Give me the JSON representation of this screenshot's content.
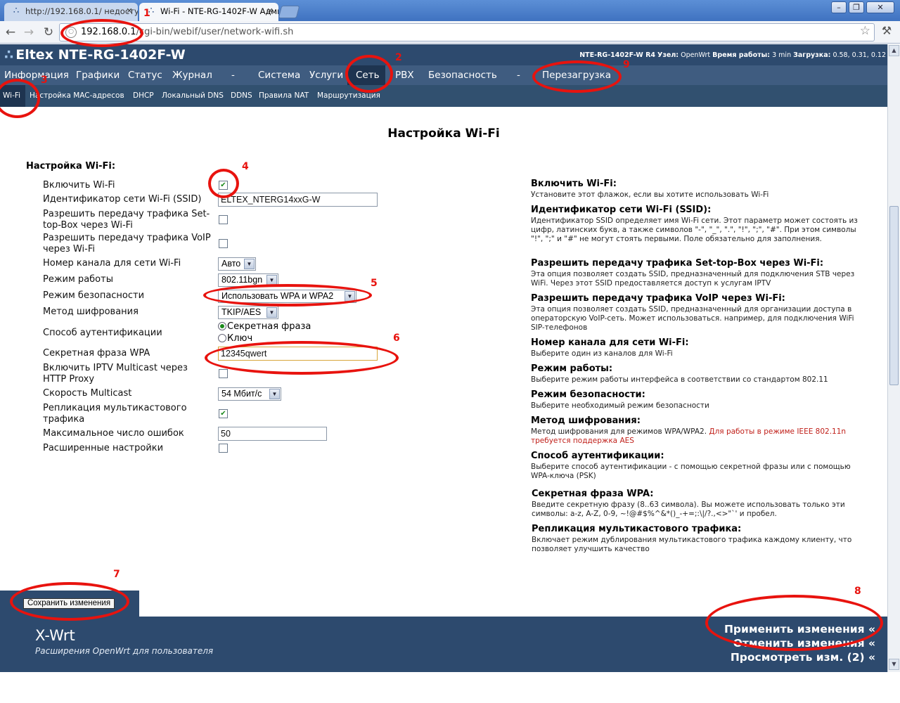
{
  "browser": {
    "tabs": [
      {
        "title": "http://192.168.0.1/ недоступ",
        "active": false
      },
      {
        "title": "Wi-Fi - NTE-RG-1402F-W Адми",
        "active": true
      }
    ],
    "url_host": "192.168.0.1",
    "url_path": "/cgi-bin/webif/user/network-wifi.sh"
  },
  "header": {
    "logo": "Eltex NTE-RG-1402F-W",
    "device": "NTE-RG-1402F-W R4",
    "node_label": "Узел:",
    "node_value": "OpenWrt",
    "uptime_label": "Время работы:",
    "uptime_value": "3 min",
    "load_label": "Загрузка:",
    "load_value": "0.58, 0.31, 0.12"
  },
  "menu_main": [
    {
      "label": "Информация",
      "active": false
    },
    {
      "label": "Графики",
      "active": false
    },
    {
      "label": "Статус",
      "active": false
    },
    {
      "label": "Журнал",
      "active": false
    },
    {
      "label": "-",
      "active": false
    },
    {
      "label": "Система",
      "active": false
    },
    {
      "label": "Услуги",
      "active": false
    },
    {
      "label": "Сеть",
      "active": true
    },
    {
      "label": "PBX",
      "active": false
    },
    {
      "label": "Безопасность",
      "active": false
    },
    {
      "label": "-",
      "active": false
    },
    {
      "label": "Перезагрузка",
      "active": false
    }
  ],
  "menu_sub": [
    {
      "label": "Wi-Fi",
      "active": true
    },
    {
      "label": "Настройка MAC-адресов",
      "active": false
    },
    {
      "label": "DHCP",
      "active": false
    },
    {
      "label": "Локальный DNS",
      "active": false
    },
    {
      "label": "DDNS",
      "active": false
    },
    {
      "label": "Правила NAT",
      "active": false
    },
    {
      "label": "Маршрутизация",
      "active": false
    }
  ],
  "page_title": "Настройка Wi-Fi",
  "section_title": "Настройка Wi-Fi:",
  "form": {
    "enable_wifi": {
      "label": "Включить Wi-Fi",
      "checked": true
    },
    "ssid": {
      "label": "Идентификатор сети Wi-Fi (SSID)",
      "value": "ELTEX_NTERG14xxG-W"
    },
    "stb": {
      "label": "Разрешить передачу трафика Set-top-Box через Wi-Fi",
      "checked": false
    },
    "voip": {
      "label": "Разрешить передачу трафика VoIP через Wi-Fi",
      "checked": false
    },
    "channel": {
      "label": "Номер канала для сети Wi-Fi",
      "value": "Авто"
    },
    "mode": {
      "label": "Режим работы",
      "value": "802.11bgn"
    },
    "security": {
      "label": "Режим безопасности",
      "value": "Использовать WPA и WPA2"
    },
    "cipher": {
      "label": "Метод шифрования",
      "value": "TKIP/AES"
    },
    "auth": {
      "label": "Способ аутентификации",
      "opt1": "Секретная фраза",
      "opt2": "Ключ",
      "selected": "opt1"
    },
    "wpa_phrase": {
      "label": "Секретная фраза WPA",
      "value": "12345qwert"
    },
    "iptv": {
      "label": "Включить IPTV Multicast через HTTP Proxy",
      "checked": false
    },
    "mcast_speed": {
      "label": "Скорость Multicast",
      "value": "54 Мбит/с"
    },
    "mcast_repl": {
      "label": "Репликация мультикастового трафика",
      "checked": true
    },
    "max_errors": {
      "label": "Максимальное число ошибок",
      "value": "50"
    },
    "advanced": {
      "label": "Расширенные настройки",
      "checked": false
    }
  },
  "help": [
    {
      "title": "Включить Wi-Fi:",
      "text": "Установите этот флажок, если вы хотите использовать Wi-Fi"
    },
    {
      "title": "Идентификатор сети Wi-Fi (SSID):",
      "text": "Идентификатор SSID определяет имя Wi-Fi сети. Этот параметр может состоять из цифр, латинских букв, а также символов \"-\", \"_\", \".\", \"!\", \";\", \"#\". При этом символы \"!\", \";\" и \"#\" не могут стоять первыми. Поле обязательно для заполнения."
    },
    {
      "title": "Разрешить передачу трафика Set-top-Box через Wi-Fi:",
      "text": "Эта опция позволяет создать SSID, предназначенный для подключения STB через WiFi. Через этот SSID предоставляется доступ к услугам IPTV"
    },
    {
      "title": "Разрешить передачу трафика VoIP через Wi-Fi:",
      "text": "Эта опция позволяет создать SSID, предназначенный для организации доступа в операторскую VoIP-сеть. Может использоваться. например, для подключения WiFi SIP-телефонов"
    },
    {
      "title": "Номер канала для сети Wi-Fi:",
      "text": "Выберите один из каналов для Wi-Fi"
    },
    {
      "title": "Режим работы:",
      "text": "Выберите режим работы интерфейса в соответствии со стандартом 802.11"
    },
    {
      "title": "Режим безопасности:",
      "text": "Выберите необходимый режим безопасности"
    },
    {
      "title": "Метод шифрования:",
      "text": "Метод шифрования для режимов WPA/WPA2.",
      "red": "Для работы в режиме IEEE 802.11n требуется поддержка AES"
    },
    {
      "title": "Способ аутентификации:",
      "text": "Выберите способ аутентификации - с помощью секретной фразы или с помощью WPA-ключа (PSK)"
    },
    {
      "title": "Секретная фраза WPA:",
      "text": "Введите секретную фразу (8..63 символа). Вы можете использовать только эти символы: a-z, A-Z, 0-9, ~!@#$%^&*()_-+=;:\\|/?.,<>\"`' и пробел."
    },
    {
      "title": "Репликация мультикастового трафика:",
      "text": "Включает режим дублирования мультикастового трафика каждому клиенту, что позволяет улучшить качество"
    }
  ],
  "save_button": "Сохранить изменения",
  "footer": {
    "brand": "X-Wrt",
    "subtitle": "Расширения OpenWrt для пользователя",
    "apply": "Применить изменения «",
    "cancel": "Отменить изменения «",
    "review": "Просмотреть изм. (2) «"
  },
  "annotations": [
    "1",
    "2",
    "3",
    "4",
    "5",
    "6",
    "7",
    "8",
    "9"
  ],
  "colors": {
    "header": "#2d4a6e",
    "annotation": "#e8130e"
  }
}
